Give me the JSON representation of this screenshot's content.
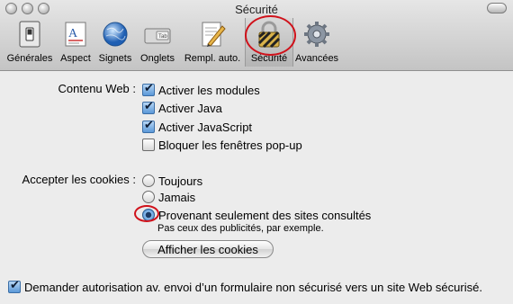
{
  "window": {
    "title": "Sécurité"
  },
  "toolbar": {
    "items": [
      {
        "label": "Générales",
        "icon": "switch-icon"
      },
      {
        "label": "Aspect",
        "icon": "font-icon"
      },
      {
        "label": "Signets",
        "icon": "globe-icon"
      },
      {
        "label": "Onglets",
        "icon": "tab-icon"
      },
      {
        "label": "Rempl. auto.",
        "icon": "pencil-icon"
      },
      {
        "label": "Sécurité",
        "icon": "lock-icon",
        "selected": true
      },
      {
        "label": "Avancées",
        "icon": "gear-icon"
      }
    ],
    "tab_icon_text": "Tab"
  },
  "web_content": {
    "label": "Contenu Web :",
    "options": [
      {
        "label": "Activer les modules",
        "checked": true
      },
      {
        "label": "Activer Java",
        "checked": true
      },
      {
        "label": "Activer JavaScript",
        "checked": true
      },
      {
        "label": "Bloquer les fenêtres pop-up",
        "checked": false
      }
    ]
  },
  "cookies": {
    "label": "Accepter les cookies :",
    "options": [
      {
        "label": "Toujours",
        "selected": false
      },
      {
        "label": "Jamais",
        "selected": false
      },
      {
        "label": "Provenant seulement des sites consultés",
        "selected": true
      }
    ],
    "hint": "Pas ceux des publicités, par exemple.",
    "show_button": "Afficher les cookies"
  },
  "form_warning": {
    "label": "Demander autorisation av. envoi d’un formulaire non sécurisé vers un site Web sécurisé.",
    "checked": true
  },
  "colors": {
    "highlight_ring": "#d0121b",
    "accent": "#3d7fc4"
  }
}
